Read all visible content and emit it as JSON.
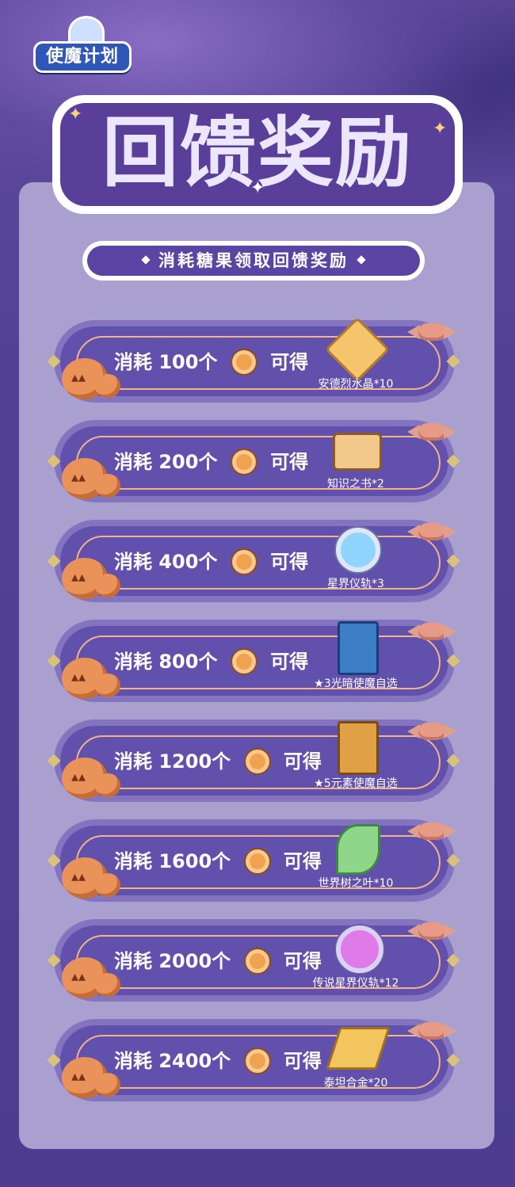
{
  "header": {
    "logo_text": "使魔计划",
    "title": "回馈奖励",
    "subtitle": "消耗糖果领取回馈奖励"
  },
  "rows": [
    {
      "consume_label": "消耗",
      "amount": "100个",
      "suffix": "可得",
      "reward": "安德烈水晶*10",
      "icon": "crystal-icon"
    },
    {
      "consume_label": "消耗",
      "amount": "200个",
      "suffix": "可得",
      "reward": "知识之书*2",
      "icon": "book-icon"
    },
    {
      "consume_label": "消耗",
      "amount": "400个",
      "suffix": "可得",
      "reward": "星界仪轨*3",
      "icon": "astral-ring-icon"
    },
    {
      "consume_label": "消耗",
      "amount": "800个",
      "suffix": "可得",
      "reward": "★3光暗使魔自选",
      "icon": "card-3star-icon"
    },
    {
      "consume_label": "消耗",
      "amount": "1200个",
      "suffix": "可得",
      "reward": "★5元素使魔自选",
      "icon": "card-5star-icon"
    },
    {
      "consume_label": "消耗",
      "amount": "1600个",
      "suffix": "可得",
      "reward": "世界树之叶*10",
      "icon": "leaf-icon"
    },
    {
      "consume_label": "消耗",
      "amount": "2000个",
      "suffix": "可得",
      "reward": "传说星界仪轨*12",
      "icon": "legend-orb-icon"
    },
    {
      "consume_label": "消耗",
      "amount": "2400个",
      "suffix": "可得",
      "reward": "泰坦合金*20",
      "icon": "titan-alloy-icon"
    }
  ],
  "colors": {
    "panel": "#a9a0cf",
    "row": "#6250ad",
    "title": "#5a3f9a",
    "accent": "#f0b58a"
  }
}
